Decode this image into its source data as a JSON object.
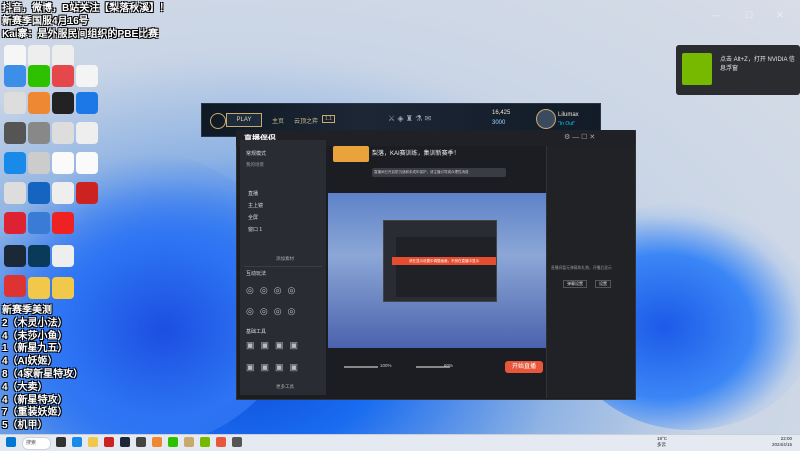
{
  "overlay": {
    "line1": "抖音，微博，B站关注【梨落秋溪】！",
    "line2": "新赛季国服4月16号",
    "line3": "Kai寨：是外服民间组织的PBE比赛"
  },
  "ranking": {
    "title": "新赛季美测",
    "items": [
      "2（木灵小法）",
      "4（未莎小鱼）",
      "1（新星九五）",
      "4（AI妖姬）",
      "8（4家新星特攻）",
      "4（大卖）",
      "4（新星特攻）",
      "7（重装妖姬）",
      "5（机甲）"
    ]
  },
  "lol_client": {
    "play_label": "PLAY",
    "nav_home": "主页",
    "nav_tft": "云顶之弈",
    "nav_badge": "1.1",
    "currency_rp": "16,425",
    "currency_be": "3000",
    "username": "Lilumax",
    "status": "\"In Out\""
  },
  "streamer": {
    "app_title": "直播伴侣",
    "room_title": "梨落，KAI赛训练，集训新赛季！",
    "notice": "直播间已开启防沉迷和未成年保护，请主播引导观众理性消费",
    "right_tab1": "弹幕",
    "right_tab2": "礼物",
    "scene_header": "常规模式",
    "scene_group": "我的场景",
    "scene_items": [
      "直播",
      "主上镜",
      "全屏",
      "窗口 1"
    ],
    "add_source": "添加素材",
    "interact_title": "互动玩法",
    "tools_title": "基础工具",
    "more_tools": "更多工具",
    "start_button": "开始直播",
    "vol_left": "100%",
    "vol_right": "60%",
    "empty_text": "直播间暂无弹幕和礼物，开播后显示",
    "right_btn1": "弹幕设置",
    "right_btn2": "设置"
  },
  "nvidia": {
    "text": "点击 Alt+Z，打开 NVIDIA 信息浮窗"
  },
  "taskbar": {
    "search_label": "搜索",
    "weather_temp": "19°C",
    "weather_desc": "多云",
    "time": "22:00",
    "date": "2024/4/15"
  },
  "preview": {
    "banner": "请在显示设置中调整画面，不然在直播中显示"
  },
  "colors": {
    "accent": "#e8573c",
    "nvidia": "#76b900",
    "lol_gold": "#c8aa6e"
  }
}
